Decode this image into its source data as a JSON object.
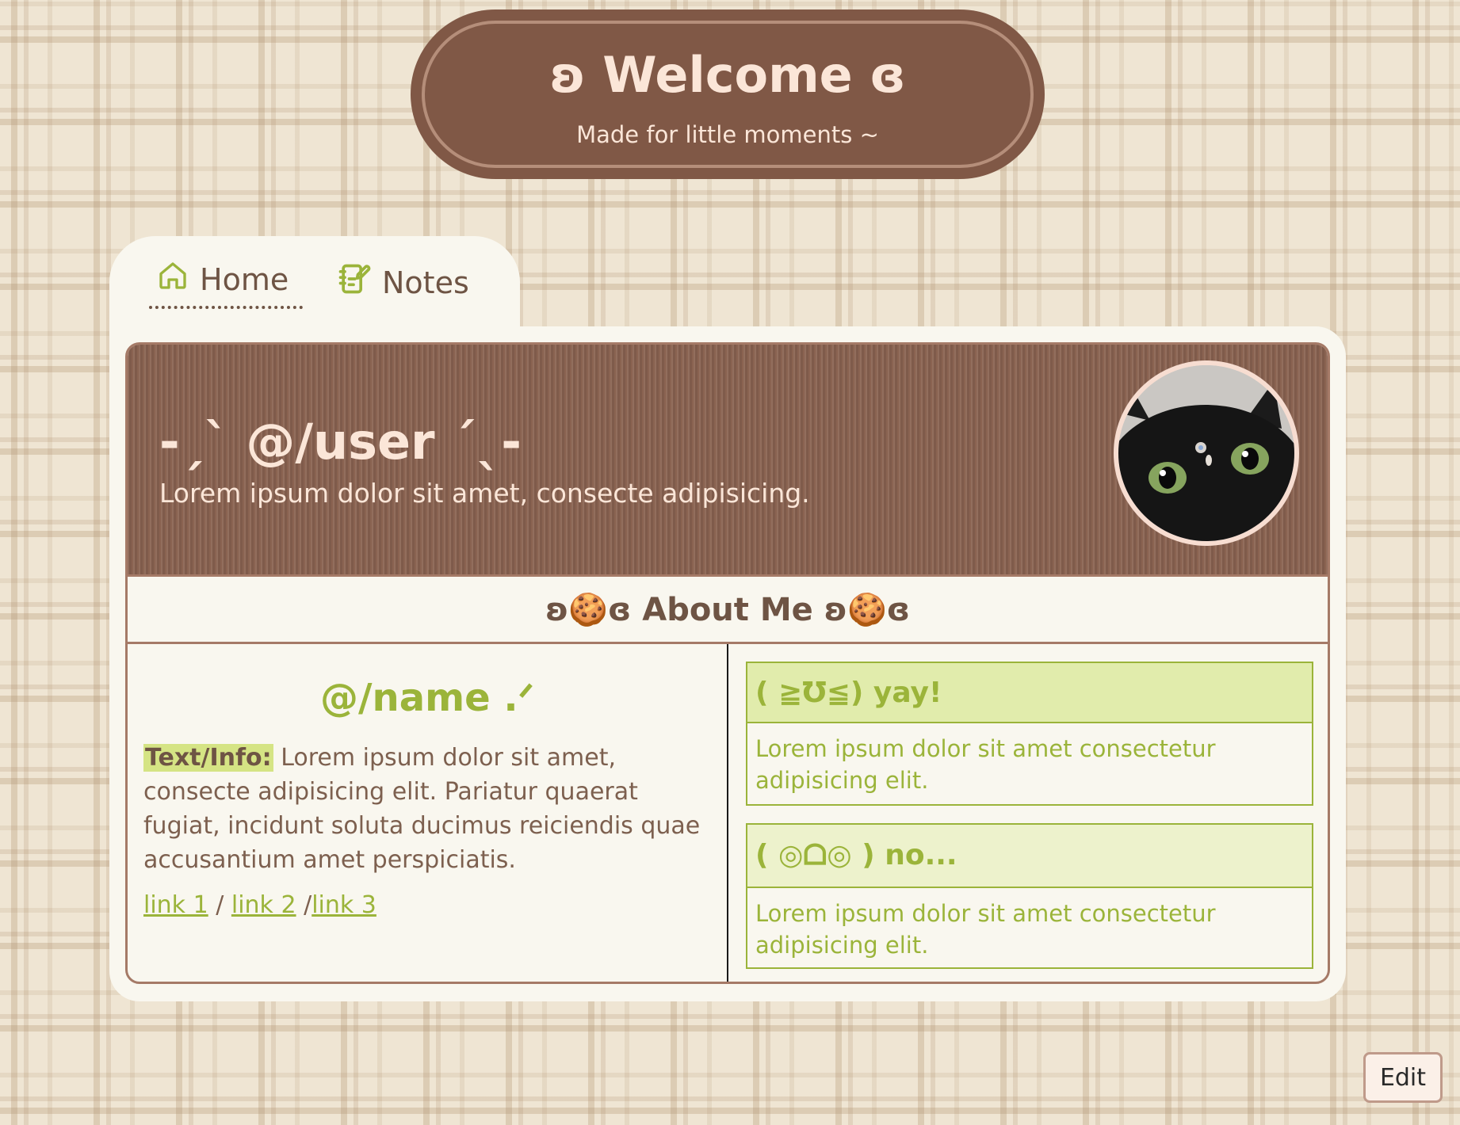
{
  "header": {
    "title": "ʚ Welcome ɞ",
    "subtitle": "Made for little moments ~"
  },
  "nav": {
    "tabs": [
      {
        "label": "Home",
        "icon": "home-icon",
        "active": true
      },
      {
        "label": "Notes",
        "icon": "notebook-icon",
        "active": false
      }
    ]
  },
  "profile": {
    "handle": "-ˏˋ @/user ˊˎ-",
    "bio": "Lorem ipsum dolor sit amet, consecte adipisicing.",
    "avatar": "black-cat-photo"
  },
  "about": {
    "heading": "ʚ🍪ɞ About Me ʚ🍪ɞ",
    "name": "@/name .ᐟ",
    "info_label": "Text/Info:",
    "info_text": " Lorem ipsum dolor sit amet, consecte adipisicing elit. Pariatur quaerat fugiat, incidunt soluta ducimus reiciendis quae accusantium amet perspiciatis.",
    "links": [
      "link 1",
      "link 2",
      "link 3"
    ],
    "link_separator_1": " / ",
    "link_separator_2": " /"
  },
  "moods": {
    "yay": {
      "title": "( ≧Ʊ≦) yay!",
      "text": "Lorem ipsum dolor sit amet consectetur adipisicing elit."
    },
    "no": {
      "title": "( ◎ᗝ◎ ) no...",
      "text": "Lorem ipsum dolor sit amet consectetur adipisicing elit."
    }
  },
  "edit_button": "Edit",
  "colors": {
    "brown": "#805846",
    "cream": "#f9f7ef",
    "green": "#9bb43a",
    "peach": "#fbe6d8"
  }
}
